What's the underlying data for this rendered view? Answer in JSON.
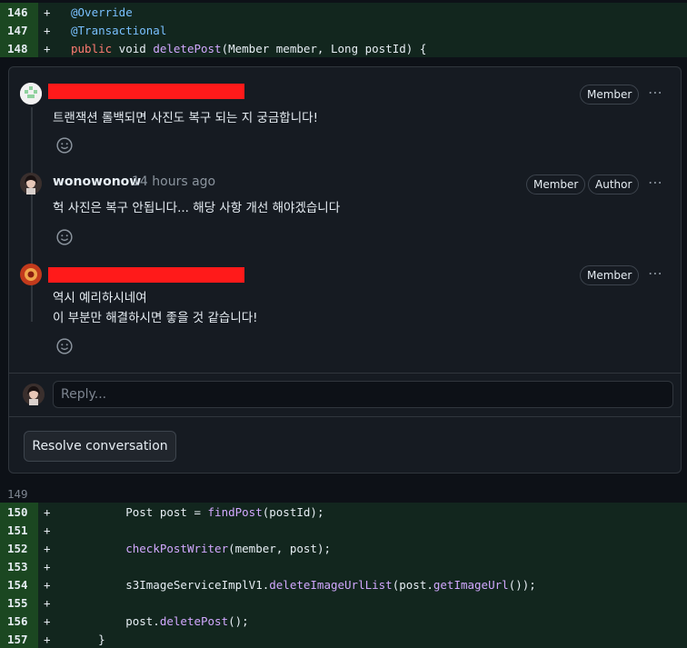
{
  "diff_top": [
    {
      "num": "146",
      "sign": "+",
      "tokens": [
        {
          "t": "@Override",
          "c": "ann"
        }
      ]
    },
    {
      "num": "147",
      "sign": "+",
      "tokens": [
        {
          "t": "@Transactional",
          "c": "ann"
        }
      ]
    },
    {
      "num": "148",
      "sign": "+",
      "tokens": [
        {
          "t": "public",
          "c": "kw"
        },
        {
          "t": " void ",
          "c": "plain"
        },
        {
          "t": "deletePost",
          "c": "fn"
        },
        {
          "t": "(Member member, Long postId) {",
          "c": "plain"
        }
      ]
    }
  ],
  "comments": [
    {
      "author_redacted": true,
      "badges": [
        "Member"
      ],
      "body_lines": [
        "트랜잭션 롤백되면 사진도 복구 되는 지 궁금합니다!"
      ]
    },
    {
      "author": "wonowonow",
      "time": "14 hours ago",
      "badges": [
        "Member",
        "Author"
      ],
      "body_lines": [
        "헉 사진은 복구 안됩니다... 해당 사항 개선 해야겠습니다"
      ]
    },
    {
      "author_redacted": true,
      "badges": [
        "Member"
      ],
      "body_lines": [
        "역시 예리하시네여",
        "이 부분만 해결하시면 좋을 것 같습니다!"
      ]
    }
  ],
  "reply": {
    "placeholder": "Reply..."
  },
  "resolve_label": "Resolve conversation",
  "diff_bottom": [
    {
      "num": "149",
      "sign": "",
      "ctx": true,
      "tokens": []
    },
    {
      "num": "150",
      "sign": "+",
      "tokens": [
        {
          "t": "        Post post = ",
          "c": "plain"
        },
        {
          "t": "findPost",
          "c": "fn"
        },
        {
          "t": "(postId);",
          "c": "plain"
        }
      ]
    },
    {
      "num": "151",
      "sign": "+",
      "tokens": []
    },
    {
      "num": "152",
      "sign": "+",
      "tokens": [
        {
          "t": "        ",
          "c": "plain"
        },
        {
          "t": "checkPostWriter",
          "c": "fn"
        },
        {
          "t": "(member, post);",
          "c": "plain"
        }
      ]
    },
    {
      "num": "153",
      "sign": "+",
      "tokens": []
    },
    {
      "num": "154",
      "sign": "+",
      "tokens": [
        {
          "t": "        s3ImageServiceImplV1.",
          "c": "plain"
        },
        {
          "t": "deleteImageUrlList",
          "c": "fn"
        },
        {
          "t": "(post.",
          "c": "plain"
        },
        {
          "t": "getImageUrl",
          "c": "fn"
        },
        {
          "t": "());",
          "c": "plain"
        }
      ]
    },
    {
      "num": "155",
      "sign": "+",
      "tokens": []
    },
    {
      "num": "156",
      "sign": "+",
      "tokens": [
        {
          "t": "        post.",
          "c": "plain"
        },
        {
          "t": "deletePost",
          "c": "fn"
        },
        {
          "t": "();",
          "c": "plain"
        }
      ]
    },
    {
      "num": "157",
      "sign": "+",
      "tokens": [
        {
          "t": "    }",
          "c": "plain"
        }
      ]
    }
  ]
}
